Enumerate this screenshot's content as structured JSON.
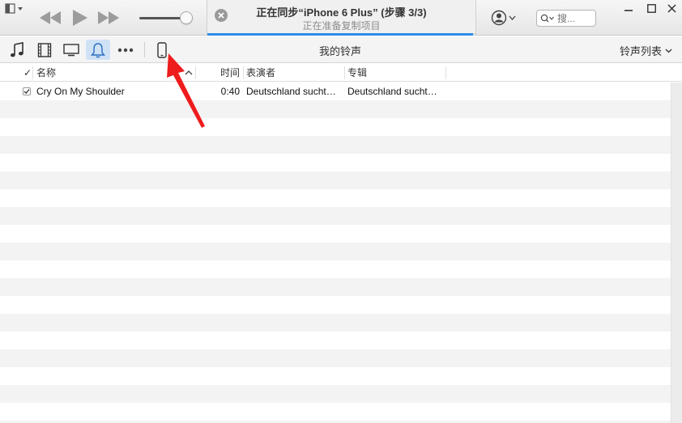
{
  "lcd": {
    "title": "正在同步“iPhone 6 Plus” (步骤 3/3)",
    "subtitle": "正在准备复制项目",
    "progress_fraction": 0.99
  },
  "search": {
    "placeholder": "搜..."
  },
  "navbar": {
    "title": "我的铃声",
    "list_label": "铃声列表"
  },
  "columns": {
    "check": "✓",
    "name": "名称",
    "time": "时间",
    "artist": "表演者",
    "album": "专辑"
  },
  "rows": [
    {
      "checked": true,
      "name": "Cry On My Shoulder",
      "time": "0:40",
      "artist": "Deutschland sucht…",
      "album": "Deutschland sucht…"
    }
  ],
  "icons": {
    "app_menu": "app-menu-icon",
    "previous": "rewind-icon",
    "play": "play-icon",
    "next": "fast-forward-icon",
    "cancel": "close-icon",
    "account": "account-icon",
    "search": "search-icon",
    "music": "music-note-icon",
    "movies": "film-icon",
    "tv": "tv-icon",
    "tones": "bell-icon",
    "more": "more-icon",
    "device": "iphone-icon"
  },
  "colors": {
    "accent": "#2c8ae8",
    "annotation_arrow": "#ee1c1c",
    "active_tab_bg": "#cfe1f5"
  }
}
